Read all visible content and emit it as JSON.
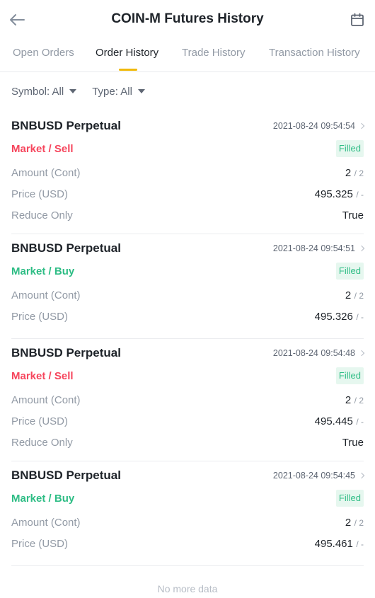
{
  "header": {
    "title": "COIN-M Futures History",
    "back_icon": "arrow-left-icon",
    "calendar_icon": "calendar-icon"
  },
  "tabs": [
    {
      "label": "Open Orders",
      "active": false
    },
    {
      "label": "Order History",
      "active": true
    },
    {
      "label": "Trade History",
      "active": false
    },
    {
      "label": "Transaction History",
      "active": false
    }
  ],
  "filters": {
    "symbol": "Symbol: All",
    "type": "Type: All"
  },
  "colors": {
    "sell": "#f6465d",
    "buy": "#2ebd85",
    "accent": "#f0b90b"
  },
  "labels": {
    "amount": "Amount (Cont)",
    "price": "Price (USD)",
    "reduce_only": "Reduce Only"
  },
  "orders": [
    {
      "symbol": "BNBUSD Perpetual",
      "time": "2021-08-24 09:54:54",
      "side": "Market / Sell",
      "status": "Filled",
      "amount": "2",
      "amount_total": "/ 2",
      "price": "495.325",
      "price_sub": "/ -",
      "reduce_only": "True"
    },
    {
      "symbol": "BNBUSD Perpetual",
      "time": "2021-08-24 09:54:51",
      "side": "Market / Buy",
      "status": "Filled",
      "amount": "2",
      "amount_total": "/ 2",
      "price": "495.326",
      "price_sub": "/ -"
    },
    {
      "symbol": "BNBUSD Perpetual",
      "time": "2021-08-24 09:54:48",
      "side": "Market / Sell",
      "status": "Filled",
      "amount": "2",
      "amount_total": "/ 2",
      "price": "495.445",
      "price_sub": "/ -",
      "reduce_only": "True"
    },
    {
      "symbol": "BNBUSD Perpetual",
      "time": "2021-08-24 09:54:45",
      "side": "Market / Buy",
      "status": "Filled",
      "amount": "2",
      "amount_total": "/ 2",
      "price": "495.461",
      "price_sub": "/ -"
    }
  ],
  "footer": {
    "no_more": "No more data"
  }
}
